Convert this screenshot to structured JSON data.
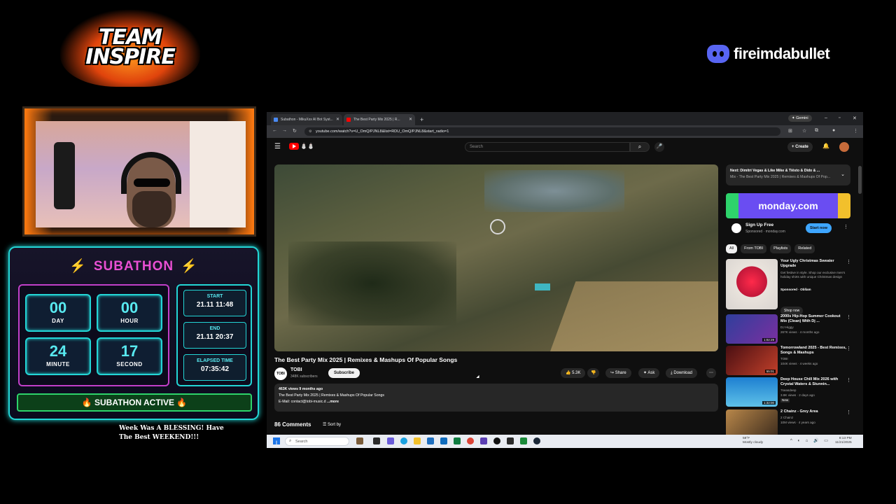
{
  "overlay": {
    "team_logo_text": "TEAM INSPIRE",
    "discord_name": "fireimdabullet",
    "subathon": {
      "title": "SUBATHON",
      "day": "00",
      "day_label": "DAY",
      "hour": "00",
      "hour_label": "HOUR",
      "minute": "24",
      "minute_label": "MINUTE",
      "second": "17",
      "second_label": "SECOND",
      "start_label": "START",
      "start_value": "21.11 11:48",
      "end_label": "END",
      "end_value": "21.11 20:37",
      "elapsed_label": "ELAPSED TIME",
      "elapsed_value": "07:35:42",
      "status": "SUBATHON ACTIVE"
    },
    "scroll_message": "Week Was A BLESSING! Have The Best WEEKEND!!!"
  },
  "browser": {
    "tabs": [
      {
        "label": "Subathon - MikuXxx AI Bot Syst..."
      },
      {
        "label": "The Best Party Mix 2025 | R..."
      }
    ],
    "gemini_label": "Gemini",
    "url": "youtube.com/watch?v=U_OmQ/PJNL8&list=RDU_OmQ/PJNL8&start_radio=1"
  },
  "youtube": {
    "search_placeholder": "Search",
    "create_label": "Create",
    "video_title": "The Best Party Mix 2025 | Remixes & Mashups Of Popular Songs",
    "channel_avatar": "TOBI",
    "channel_name": "TOBI",
    "channel_subs": "348K subscribers",
    "subscribe_label": "Subscribe",
    "likes": "5.3K",
    "share_label": "Share",
    "ask_label": "Ask",
    "download_label": "Download",
    "desc_meta": "463K views  9 months ago",
    "desc_line": "The Best Party Mix 2025 | Remixes & Mashups Of Popular Songs",
    "desc_email": "E-Mail: contact@tobi-music.d",
    "desc_more": "...more",
    "comments_count": "86 Comments",
    "sort_label": "Sort by",
    "next_title": "Next: Dimitri Vegas & Like Mike & Tiësto & Dido & ...",
    "next_sub": "Mix - The Best Party Mix 2025 | Remixes & Mashups Of Pop...",
    "ad_brand": "monday.com",
    "ad_title": "Sign Up Free",
    "ad_sponsor": "Sponsored · monday.com",
    "ad_button": "Start now",
    "chips": [
      "All",
      "From TOBI",
      "Playlists",
      "Related"
    ],
    "recs": [
      {
        "title": "Your Ugly Christmas Sweater Upgrade",
        "meta1": "Get festive in style. Shop our exclusive men's holiday shirts with unique Christmas design",
        "meta2": "Sponsored · Obllam",
        "button": "Shop now"
      },
      {
        "title": "2000s Hip-Hop Summer Cookout Mix (Clean) With Dj ...",
        "meta1": "DJ Higgy",
        "meta2": "267K views · 4 months ago",
        "duration": "1:02:29"
      },
      {
        "title": "Tomorrowland 2025 - Best Remixes, Songs & Mashups",
        "meta1": "TOBI",
        "meta2": "104K views · 4 weeks ago",
        "duration": "55:01"
      },
      {
        "title": "Deep House Chill Mix 2026 with Crystal Waters & Stunnin...",
        "meta1": "7seasdeep",
        "meta2": "3.8K views · 2 days ago",
        "badge": "New",
        "duration": "1:32:00"
      },
      {
        "title": "2 Chainz - Grey Area",
        "meta1": "2 Chainz",
        "meta2": "10M views · 4 years ago"
      }
    ]
  },
  "taskbar": {
    "search_placeholder": "Search",
    "weather_temp": "58°F",
    "weather_desc": "Mostly cloudy",
    "time": "8:13 PM",
    "date": "11/21/2025"
  }
}
